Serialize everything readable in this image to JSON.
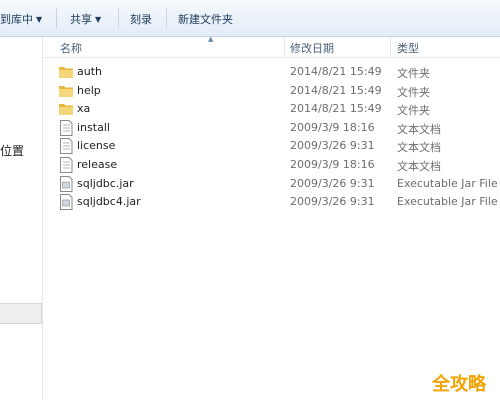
{
  "toolbar": {
    "items": [
      {
        "label": "到库中",
        "dropdown": true
      },
      {
        "label": "共享",
        "dropdown": true
      },
      {
        "label": "刻录",
        "dropdown": false
      },
      {
        "label": "新建文件夹",
        "dropdown": false
      }
    ]
  },
  "nav": {
    "selected_label": "位置"
  },
  "columns": {
    "name": "名称",
    "date": "修改日期",
    "type": "类型"
  },
  "files": [
    {
      "name": "auth",
      "date": "2014/8/21 15:49",
      "type": "文件夹",
      "icon": "folder-icon"
    },
    {
      "name": "help",
      "date": "2014/8/21 15:49",
      "type": "文件夹",
      "icon": "folder-icon"
    },
    {
      "name": "xa",
      "date": "2014/8/21 15:49",
      "type": "文件夹",
      "icon": "folder-icon"
    },
    {
      "name": "install",
      "date": "2009/3/9 18:16",
      "type": "文本文档",
      "icon": "text-document-icon"
    },
    {
      "name": "license",
      "date": "2009/3/26 9:31",
      "type": "文本文档",
      "icon": "text-document-icon"
    },
    {
      "name": "release",
      "date": "2009/3/9 18:16",
      "type": "文本文档",
      "icon": "text-document-icon"
    },
    {
      "name": "sqljdbc.jar",
      "date": "2009/3/26 9:31",
      "type": "Executable Jar File",
      "icon": "jar-file-icon"
    },
    {
      "name": "sqljdbc4.jar",
      "date": "2009/3/26 9:31",
      "type": "Executable Jar File",
      "icon": "jar-file-icon"
    }
  ],
  "watermark": "全攻略",
  "colors": {
    "folder": "#e8b83a",
    "toolbar_text": "#1e3a5f",
    "watermark": "#f2a300"
  }
}
